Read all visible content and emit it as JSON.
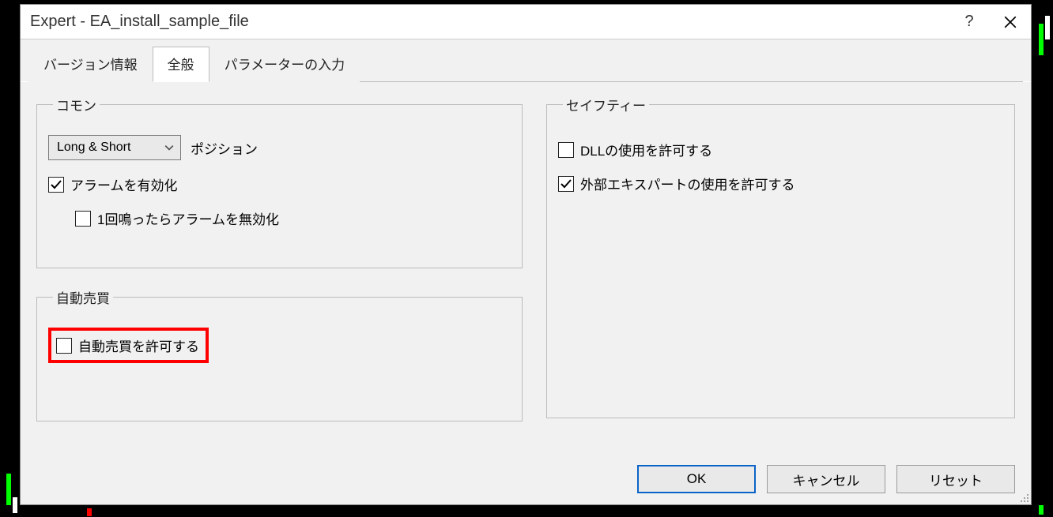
{
  "title": "Expert - EA_install_sample_file",
  "tabs": {
    "version": "バージョン情報",
    "general": "全般",
    "params": "パラメーターの入力"
  },
  "groups": {
    "common": "コモン",
    "auto": "自動売買",
    "safety": "セイフティー"
  },
  "common": {
    "position_select": "Long & Short",
    "position_label": "ポジション",
    "alarm_enable": "アラームを有効化",
    "alarm_once_disable": "1回鳴ったらアラームを無効化"
  },
  "auto": {
    "allow_auto_trading": "自動売買を許可する"
  },
  "safety": {
    "allow_dll": "DLLの使用を許可する",
    "allow_ext_expert": "外部エキスパートの使用を許可する"
  },
  "buttons": {
    "ok": "OK",
    "cancel": "キャンセル",
    "reset": "リセット"
  }
}
